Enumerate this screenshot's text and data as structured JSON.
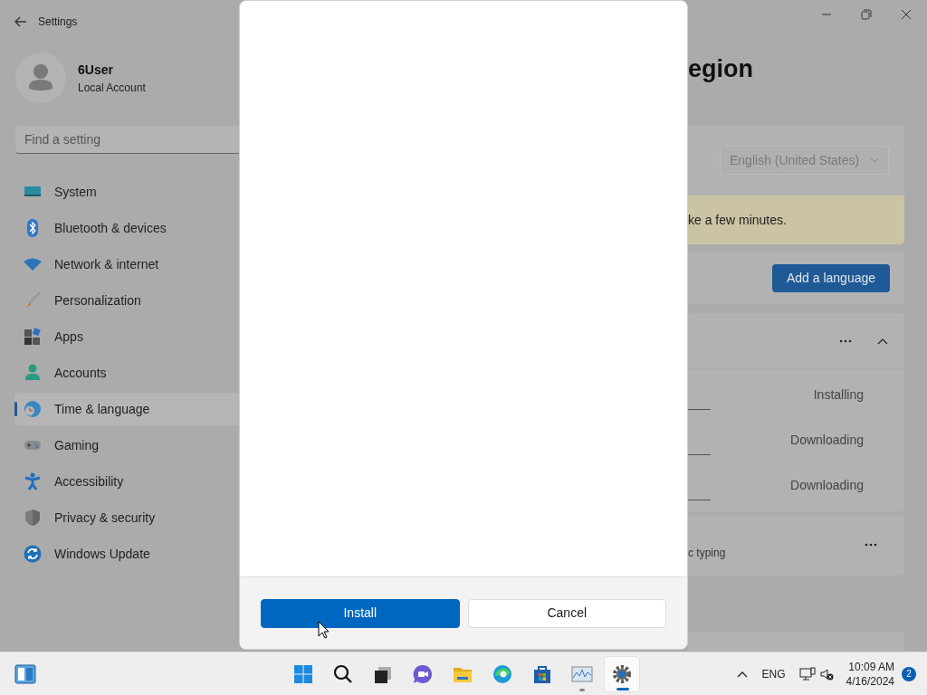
{
  "window": {
    "title": "Settings"
  },
  "account": {
    "name": "6User",
    "type": "Local Account"
  },
  "search": {
    "placeholder": "Find a setting"
  },
  "sidebar": {
    "items": [
      {
        "label": "System",
        "selected": false
      },
      {
        "label": "Bluetooth & devices",
        "selected": false
      },
      {
        "label": "Network & internet",
        "selected": false
      },
      {
        "label": "Personalization",
        "selected": false
      },
      {
        "label": "Apps",
        "selected": false
      },
      {
        "label": "Accounts",
        "selected": false
      },
      {
        "label": "Time & language",
        "selected": true
      },
      {
        "label": "Gaming",
        "selected": false
      },
      {
        "label": "Accessibility",
        "selected": false
      },
      {
        "label": "Privacy & security",
        "selected": false
      },
      {
        "label": "Windows Update",
        "selected": false
      }
    ]
  },
  "page": {
    "title": "egion",
    "display_language": "English (United States)",
    "notice": "ke a few minutes.",
    "add_button": "Add a language",
    "languages": [
      {
        "status": "Installing"
      },
      {
        "status": "Downloading"
      },
      {
        "status": "Downloading"
      }
    ],
    "typing_label": "c typing"
  },
  "dialog": {
    "buttons": [
      {
        "label": "Install",
        "kind": "primary"
      },
      {
        "label": "Cancel",
        "kind": "secondary"
      }
    ]
  },
  "taskbar": {
    "apps": [
      {
        "selected": false,
        "running": false
      },
      {
        "selected": false,
        "running": false
      },
      {
        "selected": false,
        "running": false
      },
      {
        "selected": false,
        "running": false
      },
      {
        "selected": false,
        "running": false
      },
      {
        "selected": false,
        "running": false
      },
      {
        "selected": false,
        "running": false
      },
      {
        "selected": false,
        "running": true
      },
      {
        "selected": true,
        "running": true
      }
    ],
    "tray": {
      "language": "ENG",
      "time": "10:09 AM",
      "date": "4/16/2024",
      "notifications": "2"
    }
  }
}
